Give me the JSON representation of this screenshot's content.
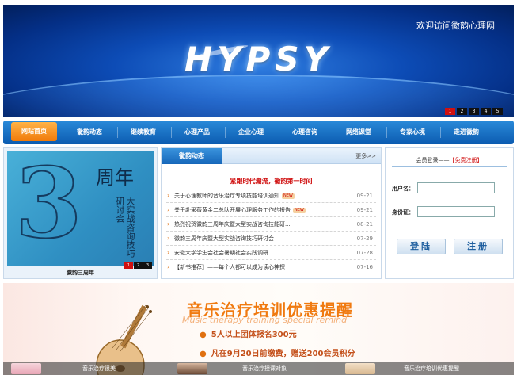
{
  "banner": {
    "welcome": "欢迎访问徽韵心理网",
    "logo": "HYPSY",
    "pager": [
      "1",
      "2",
      "3",
      "4",
      "5"
    ]
  },
  "nav": {
    "home": "网站首页",
    "items": [
      "徽韵动态",
      "继续教育",
      "心理产品",
      "企业心理",
      "心理咨询",
      "网络课堂",
      "专家心境",
      "走进徽韵"
    ]
  },
  "feature": {
    "big_digit": "3",
    "zhou": "周年",
    "sub": "大实战咨询技巧研讨会",
    "caption": "徽韵三周年",
    "pager": [
      "1",
      "2",
      "3"
    ]
  },
  "news": {
    "title": "徽韵动态",
    "more": "更多>>",
    "headline": "紧跟时代潮流，徽韵第一时间",
    "items": [
      {
        "text": "关于心理教师的音乐治疗专项技能培训通知",
        "date": "09-21",
        "new": true
      },
      {
        "text": "关于赴采薇黄金二总队开展心理服务工作的报告",
        "date": "09-21",
        "new": true
      },
      {
        "text": "热烈祝贺徽韵三周年庆暨大型实战咨询技能研...",
        "date": "08-21",
        "new": false
      },
      {
        "text": "徽韵三周年庆暨大型实战咨询技巧研讨会",
        "date": "07-29",
        "new": false
      },
      {
        "text": "安徽大学学生会社会暑期社会实践调研",
        "date": "07-28",
        "new": false
      },
      {
        "text": "【新书推荐】——每个人都可以成为读心神探",
        "date": "07-16",
        "new": false
      }
    ],
    "new_badge": "NEW"
  },
  "login": {
    "title_prefix": "会员登录——",
    "register": "【免费注册】",
    "username_label": "用户名：",
    "id_label": "身份证：",
    "login_button": "登陆",
    "register_button": "注册"
  },
  "promo": {
    "title": "音乐治疗培训优惠提醒",
    "english": "Music therapy training special remind",
    "line1": "5人以上团体报名300元",
    "line2": "凡在9月20日前缴费，赠送200会员积分",
    "thumbs": [
      "音乐治疗很美",
      "音乐治疗授课对象",
      "音乐治疗培训优惠提醒"
    ]
  },
  "colors": {
    "nav_blue": "#1566b9",
    "accent_orange": "#f07a10",
    "alert_red": "#d01010"
  }
}
